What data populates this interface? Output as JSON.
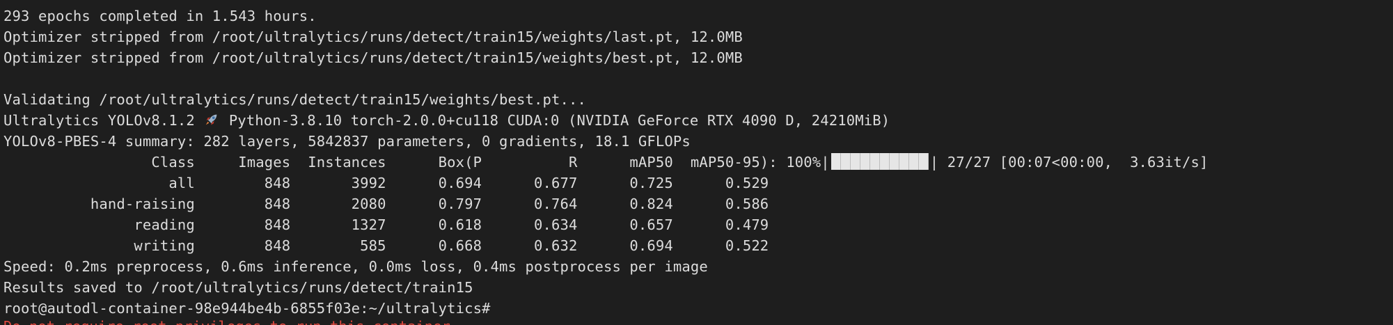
{
  "terminal": {
    "lines": {
      "l01": "293 epochs completed in 1.543 hours.",
      "l02": "Optimizer stripped from /root/ultralytics/runs/detect/train15/weights/last.pt, 12.0MB",
      "l03": "Optimizer stripped from /root/ultralytics/runs/detect/train15/weights/best.pt, 12.0MB",
      "l05": "Validating /root/ultralytics/runs/detect/train15/weights/best.pt...",
      "l06a": "Ultralytics YOLOv8.1.2 ",
      "l06b": " Python-3.8.10 torch-2.0.0+cu118 CUDA:0 (NVIDIA GeForce RTX 4090 D, 24210MiB)",
      "l07": "YOLOv8-PBES-4 summary: 282 layers, 5842837 parameters, 0 gradients, 18.1 GFLOPs",
      "l08a": "                 Class     Images  Instances      Box(P          R      mAP50  mAP50-95): 100%|",
      "l08b": "| 27/27 [00:07<00:00,  3.63it/s]",
      "l09": "                   all        848       3992      0.694      0.677      0.725      0.529",
      "l10": "          hand-raising        848       2080      0.797      0.764      0.824      0.586",
      "l11": "               reading        848       1327      0.618      0.634      0.657      0.479",
      "l12": "               writing        848        585      0.668      0.632      0.694      0.522",
      "l13": "Speed: 0.2ms preprocess, 0.6ms inference, 0.0ms loss, 0.4ms postprocess per image",
      "l14": "Results saved to /root/ultralytics/runs/detect/train15",
      "l15": "root@autodl-container-98e944be4b-6855f03e:~/ultralytics#",
      "l16": "Do not require root privileges to run this container."
    },
    "progress_percent": 100,
    "colors": {
      "background": "#1e1e1e",
      "foreground": "#dcdcdc",
      "error": "#e0483f"
    },
    "icons": {
      "rocket": "rocket-icon"
    }
  }
}
